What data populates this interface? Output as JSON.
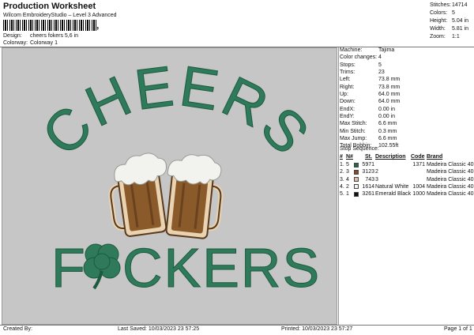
{
  "header": {
    "title": "Production Worksheet",
    "subtitle": "Wilcom EmbroideryStudio – Level 3 Advanced",
    "barcode_comma": ",",
    "design_label": "Design:",
    "design_value": "cheers fokers 5,6 in",
    "colorway_label": "Colorway:",
    "colorway_value": "Colorway 1"
  },
  "stats": [
    {
      "label": "Stitches:",
      "value": "14714"
    },
    {
      "label": "Colors:",
      "value": "5"
    },
    {
      "label": "Height:",
      "value": "5.04 in"
    },
    {
      "label": "Width:",
      "value": "5.81 in"
    },
    {
      "label": "Zoom:",
      "value": "1:1"
    }
  ],
  "machine": [
    {
      "label": "Machine:",
      "value": "Tajima"
    },
    {
      "label": "Color changes:",
      "value": "4"
    },
    {
      "label": "Stops:",
      "value": "5"
    },
    {
      "label": "Trims:",
      "value": "23"
    },
    {
      "label": "Left:",
      "value": "73.8 mm"
    },
    {
      "label": "Right:",
      "value": "73.8 mm"
    },
    {
      "label": "Up:",
      "value": "64.0 mm"
    },
    {
      "label": "Down:",
      "value": "64.0 mm"
    },
    {
      "label": "EndX:",
      "value": "0.00 in"
    },
    {
      "label": "EndY:",
      "value": "0.00 in"
    },
    {
      "label": "Max Stitch:",
      "value": "6.6 mm"
    },
    {
      "label": "Min Stitch:",
      "value": "0.3 mm"
    },
    {
      "label": "Max Jump:",
      "value": "6.6 mm"
    },
    {
      "label": "Total Bobbin:",
      "value": "102.55ft"
    }
  ],
  "stop_sequence": {
    "title": "Stop Sequence:",
    "headers": {
      "num": "#",
      "n": "N#",
      "st": "St.",
      "description": "Description",
      "code": "Code",
      "brand": "Brand"
    },
    "rows": [
      {
        "num": "1.",
        "n": "5",
        "color": "#1e6b4e",
        "st": "5971",
        "description": "",
        "code": "1371",
        "brand": "Madeira Classic 40"
      },
      {
        "num": "2.",
        "n": "3",
        "color": "#8a4a2a",
        "st": "3123",
        "description": "2",
        "code": "",
        "brand": "Madeira Classic 40"
      },
      {
        "num": "3.",
        "n": "4",
        "color": "#e8b8a8",
        "st": "743",
        "description": "3",
        "code": "",
        "brand": "Madeira Classic 40"
      },
      {
        "num": "4.",
        "n": "2",
        "color": "#f4f4f4",
        "st": "1614",
        "description": "Natural White",
        "code": "1004",
        "brand": "Madeira Classic 40"
      },
      {
        "num": "5.",
        "n": "1",
        "color": "#111111",
        "st": "3261",
        "description": "Emerald Black",
        "code": "1000",
        "brand": "Madeira Classic 40"
      }
    ]
  },
  "artwork": {
    "top_text": "CHEERS",
    "bottom_text_left": "F",
    "bottom_text_right": "CKERS",
    "green": "#2f7a5a",
    "beer": "#8b5a2b",
    "foam": "#f2f2ee"
  },
  "footer": {
    "created_by": "Created By:",
    "last_saved": "Last Saved: 10/03/2023 23 57:25",
    "printed": "Printed: 10/03/2023 23 57:27",
    "page": "Page 1 of 1"
  }
}
